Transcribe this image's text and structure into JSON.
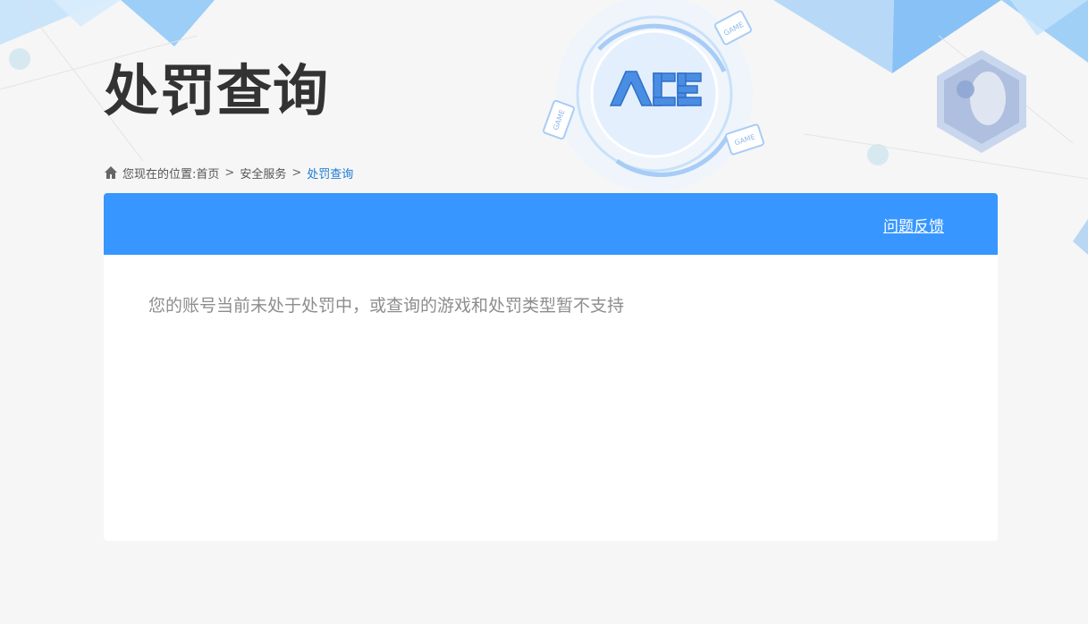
{
  "page": {
    "title": "处罚查询"
  },
  "breadcrumb": {
    "location_label": "您现在的位置:",
    "items": [
      "首页",
      "安全服务",
      "处罚查询"
    ],
    "separator": ">"
  },
  "panel": {
    "feedback_label": "问题反馈",
    "message": "您的账号当前未处于处罚中，或查询的游戏和处罚类型暂不支持"
  },
  "decor": {
    "logo_text": "ACE",
    "game_tag": "GAME"
  },
  "colors": {
    "accent": "#3796ff",
    "title": "#333333",
    "link_current": "#1a7ad4",
    "message": "#8d8d8d",
    "background": "#f6f6f6"
  }
}
